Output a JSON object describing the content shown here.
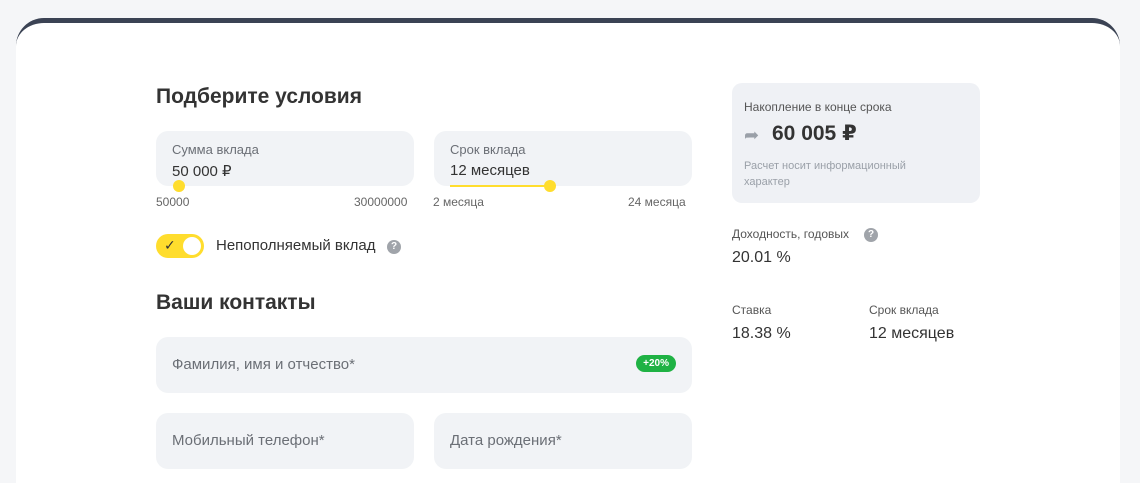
{
  "conditions": {
    "title": "Подберите условия",
    "amount": {
      "label": "Сумма вклада",
      "value": "50 000 ₽",
      "min": "50000",
      "max": "30000000",
      "slider_fraction": 0.0
    },
    "term": {
      "label": "Срок вклада",
      "value": "12 месяцев",
      "min": "2 месяца",
      "max": "24 месяца",
      "slider_fraction": 0.45
    },
    "toggle": {
      "label": "Непополняемый вклад",
      "checked": true
    }
  },
  "contacts": {
    "title": "Ваши контакты",
    "fullname_placeholder": "Фамилия, имя и отчество*",
    "fullname_badge": "+20%",
    "phone_placeholder": "Мобильный телефон*",
    "birthdate_placeholder": "Дата рождения*"
  },
  "summary": {
    "label": "Накопление в конце срока",
    "amount": "60 005 ₽",
    "note": "Расчет носит информационный характер",
    "yield_label": "Доходность, годовых",
    "yield_value": "20.01 %",
    "rate_label": "Ставка",
    "rate_value": "18.38 %",
    "term_label": "Срок вклада",
    "term_value": "12 месяцев"
  },
  "colors": {
    "accent": "#ffdd2d",
    "badge": "#1fb244",
    "header_bar": "#3b4354"
  }
}
